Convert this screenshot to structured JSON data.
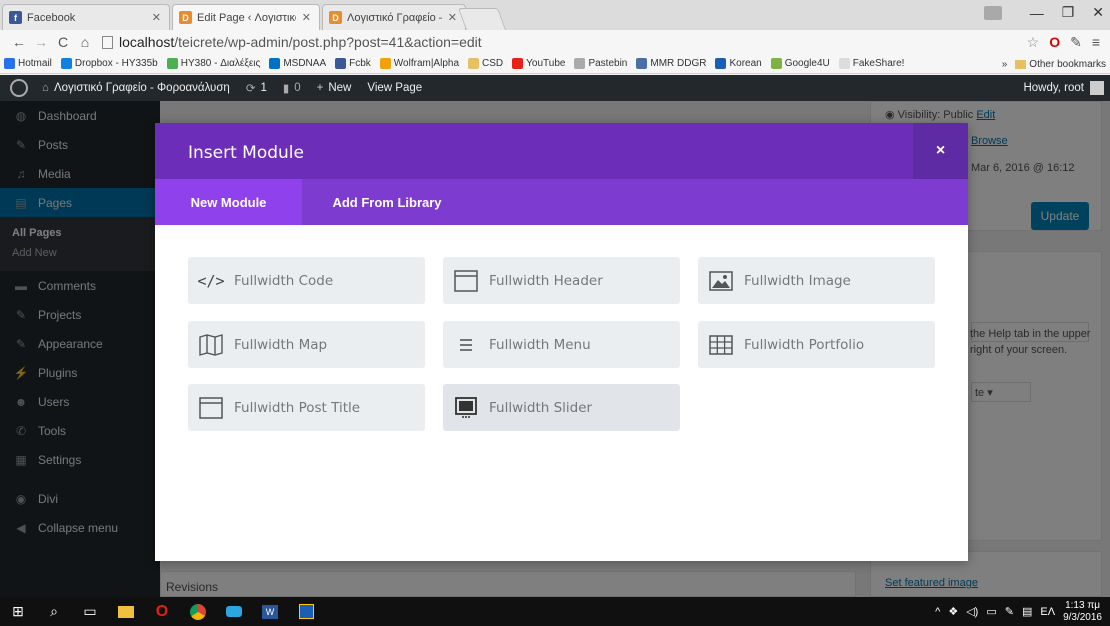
{
  "browser": {
    "tabs": [
      {
        "title": "Facebook",
        "icon": "facebook-icon",
        "color": "#3b5998",
        "active": false
      },
      {
        "title": "Edit Page ‹ Λογιστικό Γραφ",
        "icon": "divi-icon",
        "color": "#e88c2c",
        "active": true
      },
      {
        "title": "Λογιστικό Γραφείο – Φορ",
        "icon": "divi-icon",
        "color": "#e88c2c",
        "active": false
      }
    ],
    "url_host": "localhost",
    "url_path": "/teicrete/wp-admin/post.php?post=41&action=edit",
    "bookmarks": [
      {
        "label": "Hotmail",
        "color": "#2672ec"
      },
      {
        "label": "Dropbox - HY335b",
        "color": "#1081de"
      },
      {
        "label": "HY380 - Διαλέξεις",
        "color": "#4caf50"
      },
      {
        "label": "MSDNAA",
        "color": "#0072c6"
      },
      {
        "label": "Fcbk",
        "color": "#3b5998"
      },
      {
        "label": "Wolfram|Alpha",
        "color": "#f1a10a"
      },
      {
        "label": "CSD",
        "color": "#e8c064"
      },
      {
        "label": "YouTube",
        "color": "#e62117"
      },
      {
        "label": "Pastebin",
        "color": "#aaaaaa"
      },
      {
        "label": "MMR DDGR",
        "color": "#4a6fa5"
      },
      {
        "label": "Korean",
        "color": "#1a5fb4"
      },
      {
        "label": "Google4U",
        "color": "#7cb342"
      },
      {
        "label": "FakeShare!",
        "color": "#dddddd"
      }
    ],
    "bookmarks_more": "»",
    "other_bookmarks": "Other bookmarks"
  },
  "adminbar": {
    "site_name": "Λογιστικό Γραφείο - Φοροανάλυση",
    "updates": "1",
    "comments": "0",
    "new_label": "New",
    "view_page": "View Page",
    "howdy": "Howdy, root"
  },
  "sidebar": {
    "items": [
      {
        "label": "Dashboard",
        "icon": "dashboard-icon",
        "glyph": "◍"
      },
      {
        "label": "Posts",
        "icon": "pin-icon",
        "glyph": "✎"
      },
      {
        "label": "Media",
        "icon": "media-icon",
        "glyph": "♫"
      },
      {
        "label": "Pages",
        "icon": "pages-icon",
        "glyph": "▤"
      }
    ],
    "submenu": [
      "All Pages",
      "Add New"
    ],
    "items2": [
      {
        "label": "Comments",
        "icon": "comments-icon",
        "glyph": "▬"
      },
      {
        "label": "Projects",
        "icon": "projects-icon",
        "glyph": "✎"
      },
      {
        "label": "Appearance",
        "icon": "appearance-icon",
        "glyph": "✎"
      },
      {
        "label": "Plugins",
        "icon": "plugins-icon",
        "glyph": "⚡"
      },
      {
        "label": "Users",
        "icon": "users-icon",
        "glyph": "☻"
      },
      {
        "label": "Tools",
        "icon": "tools-icon",
        "glyph": "✆"
      },
      {
        "label": "Settings",
        "icon": "settings-icon",
        "glyph": "▦"
      },
      {
        "label": "Divi",
        "icon": "divi-icon",
        "glyph": "◉"
      },
      {
        "label": "Collapse menu",
        "icon": "collapse-icon",
        "glyph": "◀"
      }
    ]
  },
  "publish": {
    "visibility": "Visibility: Public",
    "visibility_edit": "Edit",
    "browse": "Browse",
    "published_on": "Mar 6, 2016 @ 16:12",
    "update": "Update"
  },
  "page_attrs": {
    "select_suffix": "te",
    "help": "the Help tab in the upper right of your screen."
  },
  "revisions": "Revisions",
  "featured_image": "Set featured image",
  "modal": {
    "title": "Insert Module",
    "close": "×",
    "tabs": [
      "New Module",
      "Add From Library"
    ],
    "modules": [
      {
        "label": "Fullwidth Code",
        "icon": "code-icon"
      },
      {
        "label": "Fullwidth Header",
        "icon": "header-icon"
      },
      {
        "label": "Fullwidth Image",
        "icon": "image-icon"
      },
      {
        "label": "Fullwidth Map",
        "icon": "map-icon"
      },
      {
        "label": "Fullwidth Menu",
        "icon": "menu-icon"
      },
      {
        "label": "Fullwidth Portfolio",
        "icon": "portfolio-icon"
      },
      {
        "label": "Fullwidth Post Title",
        "icon": "post-title-icon"
      },
      {
        "label": "Fullwidth Slider",
        "icon": "slider-icon"
      }
    ]
  },
  "taskbar": {
    "language": "ΕΛ",
    "time": "1:13 πμ",
    "date": "9/3/2016"
  }
}
